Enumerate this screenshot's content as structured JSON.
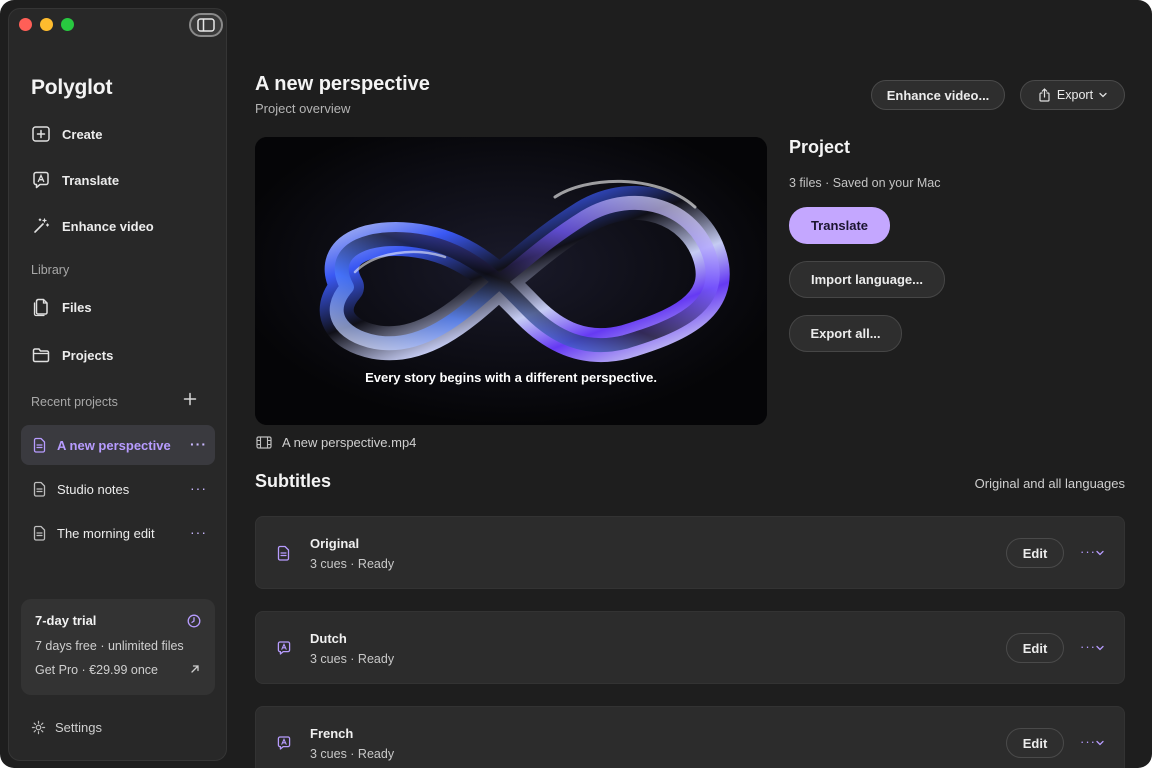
{
  "sidebar": {
    "brand": "Polyglot",
    "nav": [
      {
        "label": "Create",
        "icon": "plus-square-icon"
      },
      {
        "label": "Translate",
        "icon": "translate-bubble-icon"
      },
      {
        "label": "Enhance video",
        "icon": "magic-wand-icon"
      }
    ],
    "library_label": "Library",
    "library": [
      {
        "label": "Files",
        "icon": "files-icon"
      },
      {
        "label": "Projects",
        "icon": "folder-icon"
      }
    ],
    "recent_label": "Recent projects",
    "recent": [
      {
        "label": "A new perspective",
        "active": true
      },
      {
        "label": "Studio notes",
        "active": false
      },
      {
        "label": "The morning edit",
        "active": false
      }
    ],
    "trial": {
      "title": "7-day trial",
      "subtitle": "7 days free · unlimited files",
      "cta": "Get Pro · €29.99 once"
    },
    "settings_label": "Settings"
  },
  "header": {
    "title": "A new perspective",
    "subtitle": "Project overview",
    "enhance_label": "Enhance video...",
    "export_label": "Export"
  },
  "video": {
    "caption": "Every story begins with a different perspective.",
    "filename": "A new perspective.mp4"
  },
  "project": {
    "title": "Project",
    "meta": "3 files · Saved on your Mac",
    "translate_label": "Translate",
    "import_label": "Import language...",
    "export_all_label": "Export all..."
  },
  "subtitles": {
    "title": "Subtitles",
    "filter": "Original and all languages",
    "edit_label": "Edit",
    "rows": [
      {
        "name": "Original",
        "status": "3 cues · Ready",
        "icon": "document-icon"
      },
      {
        "name": "Dutch",
        "status": "3 cues · Ready",
        "icon": "translate-bubble-icon"
      },
      {
        "name": "French",
        "status": "3 cues · Ready",
        "icon": "translate-bubble-icon"
      }
    ]
  },
  "colors": {
    "accent": "#c4a7ff",
    "accent_text": "#b79cff",
    "window_bg": "#1e1e1e",
    "sidebar_bg": "#282828"
  }
}
